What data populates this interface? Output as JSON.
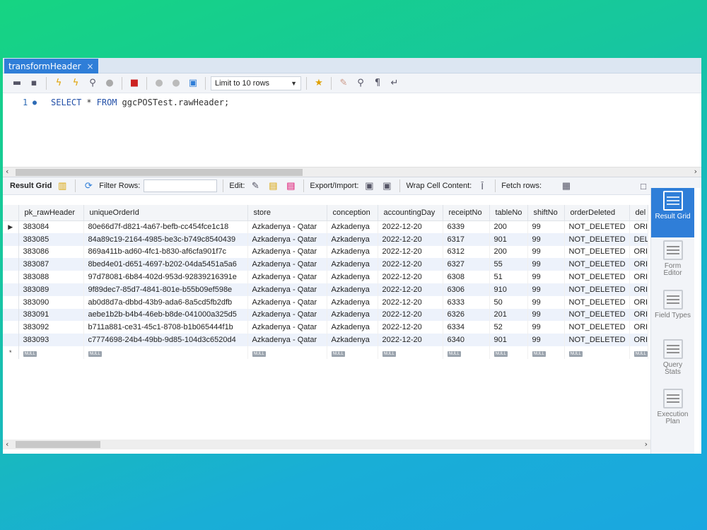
{
  "tab": {
    "title": "transformHeader",
    "close": "×"
  },
  "toolbar": {
    "limit_label": "Limit to 10 rows"
  },
  "editor": {
    "line_number": "1",
    "kw_select": "SELECT",
    "star": "*",
    "kw_from": "FROM",
    "table": "ggcPOSTest.rawHeader;"
  },
  "result_toolbar": {
    "result_grid": "Result Grid",
    "filter_rows": "Filter Rows:",
    "edit": "Edit:",
    "export_import": "Export/Import:",
    "wrap_cell": "Wrap Cell Content:",
    "fetch_rows": "Fetch rows:"
  },
  "columns": [
    "pk_rawHeader",
    "uniqueOrderId",
    "store",
    "conception",
    "accountingDay",
    "receiptNo",
    "tableNo",
    "shiftNo",
    "orderDeleted",
    "del"
  ],
  "rows": [
    [
      "383084",
      "80e66d7f-d821-4a67-befb-cc454fce1c18",
      "Azkadenya - Qatar",
      "Azkadenya",
      "2022-12-20",
      "6339",
      "200",
      "99",
      "NOT_DELETED",
      "ORI"
    ],
    [
      "383085",
      "84a89c19-2164-4985-be3c-b749c8540439",
      "Azkadenya - Qatar",
      "Azkadenya",
      "2022-12-20",
      "6317",
      "901",
      "99",
      "NOT_DELETED",
      "DEL"
    ],
    [
      "383086",
      "869a411b-ad60-4fc1-b830-af6cfa901f7c",
      "Azkadenya - Qatar",
      "Azkadenya",
      "2022-12-20",
      "6312",
      "200",
      "99",
      "NOT_DELETED",
      "ORI"
    ],
    [
      "383087",
      "8bed4e01-d651-4697-b202-04da5451a5a6",
      "Azkadenya - Qatar",
      "Azkadenya",
      "2022-12-20",
      "6327",
      "55",
      "99",
      "NOT_DELETED",
      "ORI"
    ],
    [
      "383088",
      "97d78081-6b84-402d-953d-92839216391e",
      "Azkadenya - Qatar",
      "Azkadenya",
      "2022-12-20",
      "6308",
      "51",
      "99",
      "NOT_DELETED",
      "ORI"
    ],
    [
      "383089",
      "9f89dec7-85d7-4841-801e-b55b09ef598e",
      "Azkadenya - Qatar",
      "Azkadenya",
      "2022-12-20",
      "6306",
      "910",
      "99",
      "NOT_DELETED",
      "ORI"
    ],
    [
      "383090",
      "ab0d8d7a-dbbd-43b9-ada6-8a5cd5fb2dfb",
      "Azkadenya - Qatar",
      "Azkadenya",
      "2022-12-20",
      "6333",
      "50",
      "99",
      "NOT_DELETED",
      "ORI"
    ],
    [
      "383091",
      "aebe1b2b-b4b4-46eb-b8de-041000a325d5",
      "Azkadenya - Qatar",
      "Azkadenya",
      "2022-12-20",
      "6326",
      "201",
      "99",
      "NOT_DELETED",
      "ORI"
    ],
    [
      "383092",
      "b711a881-ce31-45c1-8708-b1b065444f1b",
      "Azkadenya - Qatar",
      "Azkadenya",
      "2022-12-20",
      "6334",
      "52",
      "99",
      "NOT_DELETED",
      "ORI"
    ],
    [
      "383093",
      "c7774698-24b4-49bb-9d85-104d3c6520d4",
      "Azkadenya - Qatar",
      "Azkadenya",
      "2022-12-20",
      "6340",
      "901",
      "99",
      "NOT_DELETED",
      "ORI"
    ]
  ],
  "null_label": "NULL",
  "side_panel": [
    {
      "label": "Result Grid",
      "active": true
    },
    {
      "label": "Form Editor",
      "active": false
    },
    {
      "label": "Field Types",
      "active": false
    },
    {
      "label": "Query Stats",
      "active": false
    },
    {
      "label": "Execution Plan",
      "active": false
    }
  ],
  "colors": {
    "accent": "#2f7ed8",
    "row_alt": "#edf2fb"
  },
  "icons": [
    "open-folder-icon",
    "save-icon",
    "execute-icon",
    "execute-current-icon",
    "explain-icon",
    "stop-icon",
    "toggle-error-icon",
    "commit-icon",
    "rollback-icon",
    "autocommit-icon",
    "beautify-icon",
    "clean-icon",
    "find-icon",
    "invisible-chars-icon",
    "wrap-icon"
  ]
}
